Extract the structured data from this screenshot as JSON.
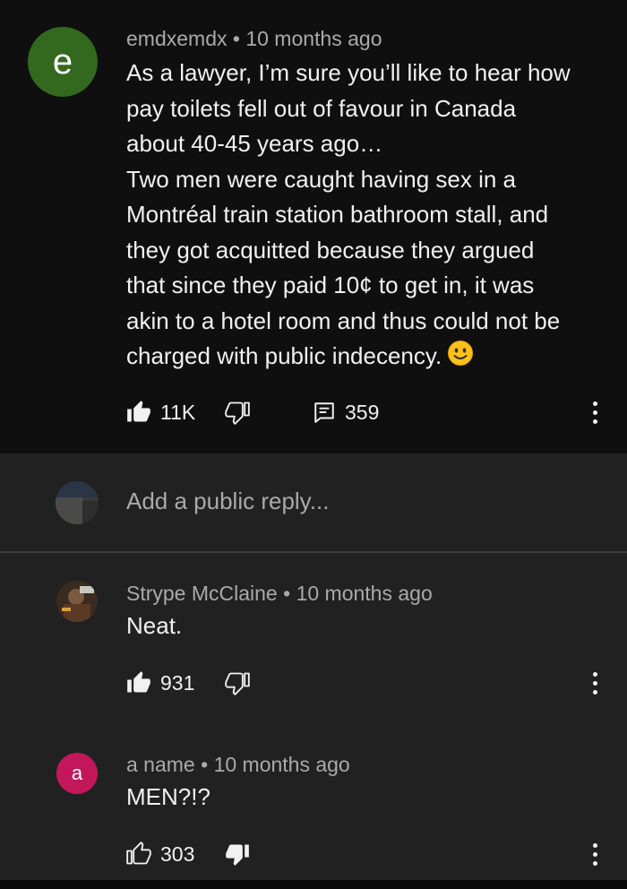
{
  "comments": [
    {
      "avatar_letter": "e",
      "avatar_color": "#33691e",
      "author": "emdxemdx",
      "time": "10 months ago",
      "text_lines": [
        "As a lawyer, I’m sure you’ll like to hear how",
        "pay toilets fell out of favour in Canada",
        "about 40-45 years ago…",
        "Two men were caught having sex in a",
        "Montréal train station bathroom stall, and",
        "they got acquitted because they argued",
        "that since they paid 10¢ to get in, it was",
        "akin to a hotel room and thus could not be",
        "charged with public indecency."
      ],
      "emoji": "slightly-smiling-face-icon",
      "likes": "11K",
      "replies": "359"
    },
    {
      "author": "Strype McClaine",
      "time": "10 months ago",
      "text": "Neat.",
      "likes": "931"
    },
    {
      "avatar_letter": "a",
      "avatar_color": "#c2185b",
      "author": "a name",
      "time": "10 months ago",
      "text": "MEN?!?",
      "likes": "303"
    }
  ],
  "reply_box": {
    "placeholder": "Add a public reply..."
  },
  "separator": "•",
  "icons": {
    "like": "thumbs-up-icon",
    "dislike": "thumbs-down-icon",
    "reply": "comment-icon",
    "more": "more-vert-icon"
  },
  "colors": {
    "background_top": "#0f0f0f",
    "background_lower": "#212121",
    "meta_text": "#aaaaaa",
    "body_text": "#f1f1f1"
  }
}
